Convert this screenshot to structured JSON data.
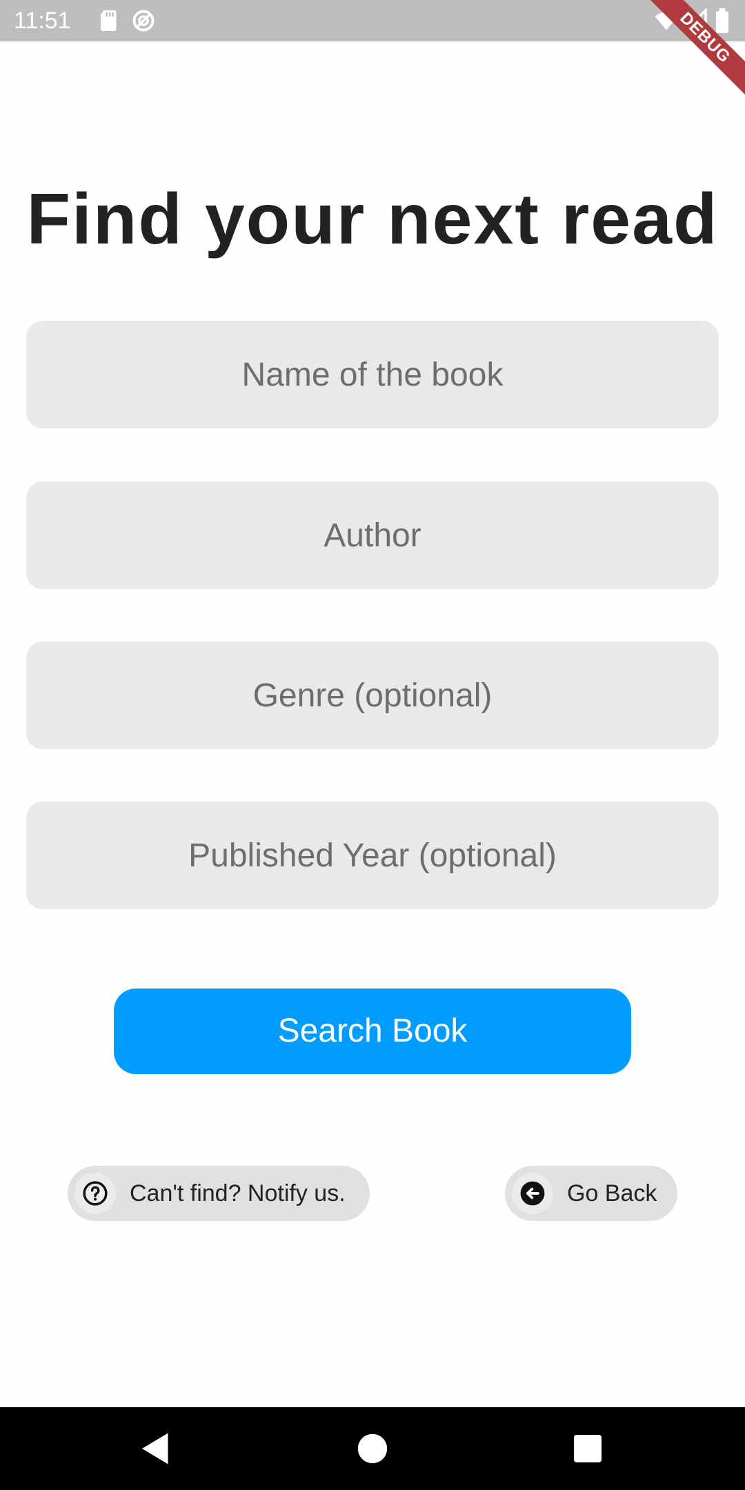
{
  "status_bar": {
    "time": "11:51",
    "icons": [
      "sd-card-icon",
      "sync-icon",
      "wifi-icon",
      "signal-icon",
      "battery-icon"
    ],
    "debug_label": "DEBUG"
  },
  "page": {
    "title": "Find your next read"
  },
  "form": {
    "book_name_placeholder": "Name of the book",
    "author_placeholder": "Author",
    "genre_placeholder": "Genre (optional)",
    "year_placeholder": "Published Year (optional)"
  },
  "actions": {
    "search_label": "Search Book",
    "notify_label": "Can't find? Notify us.",
    "back_label": "Go Back"
  },
  "nav_bar": {
    "buttons": [
      "back-triangle-icon",
      "home-circle-icon",
      "recents-square-icon"
    ]
  },
  "colors": {
    "accent": "#009cff",
    "field_bg": "#e9e9e9",
    "pill_bg": "#e0e0e0",
    "status_bar": "#bdbdbd",
    "debug_ribbon": "#b13a3e"
  }
}
